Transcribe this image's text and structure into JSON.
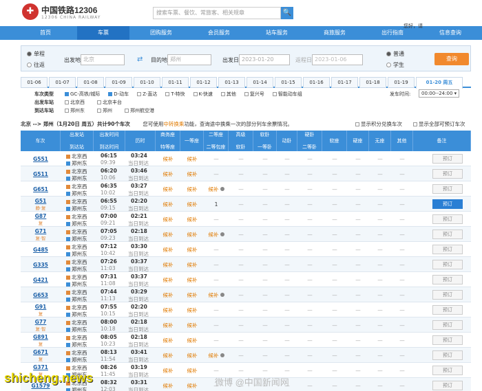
{
  "header": {
    "logo_cn": "中国铁路12306",
    "logo_en": "12306 CHINA RAILWAY",
    "search_placeholder": "搜索车票、餐饮、常旅客、相关规章",
    "logo_glyph": "✚",
    "search_glyph": "🔍"
  },
  "nav": {
    "items": [
      "首页",
      "车票",
      "团购服务",
      "会员服务",
      "站车服务",
      "商旅服务",
      "出行指南",
      "信息查询"
    ],
    "links": "您好，请"
  },
  "form": {
    "trip_single": "单程",
    "trip_round": "往返",
    "from_label": "出发地",
    "from_value": "北京",
    "to_label": "目的地",
    "to_value": "郑州",
    "depart_label": "出发日",
    "depart_value": "2023-01-20",
    "return_label": "返程日",
    "return_value": "2023-01-06",
    "ticket_normal": "普通",
    "ticket_student": "学生",
    "query_button": "查询",
    "swap_glyph": "⇄"
  },
  "dates": [
    "01-06",
    "01-07",
    "01-08",
    "01-09",
    "01-10",
    "01-11",
    "01-12",
    "01-13",
    "01-14",
    "01-15",
    "01-16",
    "01-17",
    "01-18",
    "01-19",
    "01-20 周五"
  ],
  "filters": {
    "type_label": "车次类型",
    "types": [
      "GC-高铁/城际",
      "D-动车",
      "Z-直达",
      "T-特快",
      "K-快速",
      "其他",
      "复兴号",
      "智能动车组"
    ],
    "from_station_label": "出发车站",
    "from_stations": [
      "北京西",
      "北京丰台"
    ],
    "to_station_label": "到达车站",
    "to_stations": [
      "郑州东",
      "郑州",
      "郑州航空港"
    ],
    "time_label": "发车时间:",
    "time_value": "00:00--24:00"
  },
  "summary": {
    "route": "北京 --> 郑州（1月20日  周五）共计",
    "count": "90",
    "unit": "个车次",
    "note_pre": "您可使用",
    "note_hl": "中转换乘",
    "note_post": "功能，查询途中换乘一次的部分列车余票情况。",
    "opt1": "显示积分兑换车次",
    "opt2": "显示全部可预订车次"
  },
  "columns": [
    "车次",
    "出发站\n到达站",
    "出发时间\n到达时间",
    "历时",
    "商务座\n特等座",
    "一等座",
    "二等座\n二等包座",
    "高级\n软卧",
    "软卧\n一等卧",
    "动卧",
    "硬卧\n二等卧",
    "软座",
    "硬座",
    "无座",
    "其他",
    "备注"
  ],
  "trains": [
    {
      "no": "G551",
      "tag": "",
      "from": "北京西",
      "to": "郑州东",
      "dep": "06:15",
      "arr": "09:39",
      "dur": "03:24",
      "day": "当日到达",
      "biz": "候补",
      "first": "候补",
      "second": "—",
      "book": "预订",
      "book_on": false
    },
    {
      "no": "G511",
      "tag": "",
      "from": "北京西",
      "to": "郑州东",
      "dep": "06:20",
      "arr": "10:06",
      "dur": "03:46",
      "day": "当日到达",
      "biz": "候补",
      "first": "候补",
      "second": "—",
      "book": "预订",
      "book_on": false
    },
    {
      "no": "G651",
      "tag": "",
      "from": "北京西",
      "to": "郑州东",
      "dep": "06:35",
      "arr": "10:02",
      "dur": "03:27",
      "day": "当日到达",
      "biz": "候补",
      "first": "候补",
      "second": "候补",
      "book": "预订",
      "book_on": false
    },
    {
      "no": "G51",
      "tag": "静·复",
      "from": "北京西",
      "to": "郑州东",
      "dep": "06:55",
      "arr": "09:15",
      "dur": "02:20",
      "day": "当日到达",
      "biz": "候补",
      "first": "候补",
      "second": "1",
      "book": "预订",
      "book_on": true
    },
    {
      "no": "G87",
      "tag": "复",
      "from": "北京西",
      "to": "郑州东",
      "dep": "07:00",
      "arr": "09:21",
      "dur": "02:21",
      "day": "当日到达",
      "biz": "候补",
      "first": "候补",
      "second": "—",
      "book": "预订",
      "book_on": false
    },
    {
      "no": "G71",
      "tag": "复·智",
      "from": "北京西",
      "to": "郑州东",
      "dep": "07:05",
      "arr": "09:23",
      "dur": "02:18",
      "day": "当日到达",
      "biz": "候补",
      "first": "候补",
      "second": "候补",
      "book": "预订",
      "book_on": false
    },
    {
      "no": "G485",
      "tag": "",
      "from": "北京西",
      "to": "郑州东",
      "dep": "07:12",
      "arr": "10:42",
      "dur": "03:30",
      "day": "当日到达",
      "biz": "候补",
      "first": "候补",
      "second": "—",
      "book": "预订",
      "book_on": false
    },
    {
      "no": "G335",
      "tag": "",
      "from": "北京西",
      "to": "郑州东",
      "dep": "07:26",
      "arr": "11:03",
      "dur": "03:37",
      "day": "当日到达",
      "biz": "候补",
      "first": "候补",
      "second": "—",
      "book": "预订",
      "book_on": false
    },
    {
      "no": "G421",
      "tag": "",
      "from": "北京西",
      "to": "郑州东",
      "dep": "07:31",
      "arr": "11:08",
      "dur": "03:37",
      "day": "当日到达",
      "biz": "候补",
      "first": "候补",
      "second": "—",
      "book": "预订",
      "book_on": false
    },
    {
      "no": "G653",
      "tag": "",
      "from": "北京西",
      "to": "郑州东",
      "dep": "07:44",
      "arr": "11:13",
      "dur": "03:29",
      "day": "当日到达",
      "biz": "候补",
      "first": "候补",
      "second": "候补",
      "book": "预订",
      "book_on": false
    },
    {
      "no": "G91",
      "tag": "复",
      "from": "北京西",
      "to": "郑州东",
      "dep": "07:55",
      "arr": "10:15",
      "dur": "02:20",
      "day": "当日到达",
      "biz": "候补",
      "first": "候补",
      "second": "—",
      "book": "预订",
      "book_on": false
    },
    {
      "no": "G77",
      "tag": "复·智",
      "from": "北京西",
      "to": "郑州东",
      "dep": "08:00",
      "arr": "10:18",
      "dur": "02:18",
      "day": "当日到达",
      "biz": "候补",
      "first": "候补",
      "second": "—",
      "book": "预订",
      "book_on": false
    },
    {
      "no": "G891",
      "tag": "复",
      "from": "北京西",
      "to": "郑州东",
      "dep": "08:05",
      "arr": "10:23",
      "dur": "02:18",
      "day": "当日到达",
      "biz": "候补",
      "first": "候补",
      "second": "—",
      "book": "预订",
      "book_on": false
    },
    {
      "no": "G671",
      "tag": "复",
      "from": "北京西",
      "to": "郑州东",
      "dep": "08:13",
      "arr": "11:54",
      "dur": "03:41",
      "day": "当日到达",
      "biz": "候补",
      "first": "候补",
      "second": "候补",
      "book": "预订",
      "book_on": false
    },
    {
      "no": "G371",
      "tag": "复",
      "from": "北京西",
      "to": "郑州东",
      "dep": "08:26",
      "arr": "11:45",
      "dur": "03:19",
      "day": "当日到达",
      "biz": "候补",
      "first": "候补",
      "second": "—",
      "book": "预订",
      "book_on": false
    },
    {
      "no": "G1579",
      "tag": "",
      "from": "北京西",
      "to": "郑州东",
      "dep": "08:32",
      "arr": "12:03",
      "dur": "03:31",
      "day": "当日到达",
      "biz": "候补",
      "first": "候补",
      "second": "—",
      "book": "预订",
      "book_on": false
    }
  ],
  "watermarks": {
    "left": "shicheng.news",
    "right": "微博 @中国新闻网"
  }
}
